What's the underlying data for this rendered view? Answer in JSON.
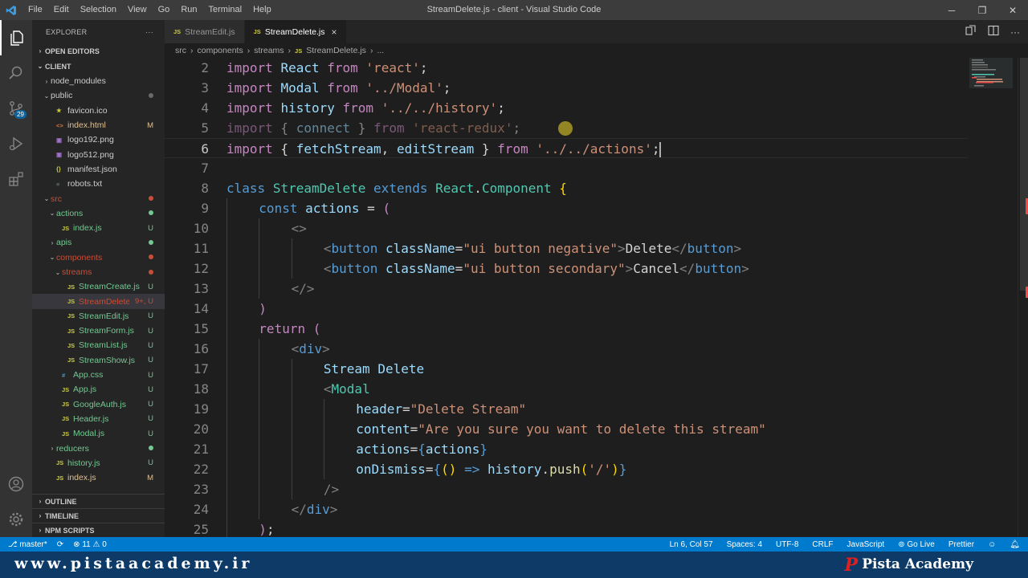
{
  "window": {
    "title": "StreamDelete.js - client - Visual Studio Code",
    "menu": [
      "File",
      "Edit",
      "Selection",
      "View",
      "Go",
      "Run",
      "Terminal",
      "Help"
    ]
  },
  "activity_badge": "29",
  "explorer": {
    "header": "EXPLORER",
    "more": "···",
    "open_editors": "OPEN EDITORS",
    "root": "CLIENT",
    "tree": [
      {
        "name": "node_modules",
        "icon": "folder",
        "depth": 1,
        "status": ""
      },
      {
        "name": "public",
        "icon": "folder-open",
        "depth": 1,
        "status": "dot",
        "status_color": "#6a6a6a"
      },
      {
        "name": "favicon.ico",
        "icon": "star",
        "depth": 2,
        "status": ""
      },
      {
        "name": "index.html",
        "icon": "html",
        "depth": 2,
        "status": "M"
      },
      {
        "name": "logo192.png",
        "icon": "image",
        "depth": 2,
        "status": ""
      },
      {
        "name": "logo512.png",
        "icon": "image",
        "depth": 2,
        "status": ""
      },
      {
        "name": "manifest.json",
        "icon": "json",
        "depth": 2,
        "status": ""
      },
      {
        "name": "robots.txt",
        "icon": "text",
        "depth": 2,
        "status": ""
      },
      {
        "name": "src",
        "icon": "folder-open",
        "depth": 1,
        "status": "dot",
        "status_color": "#c74e39"
      },
      {
        "name": "actions",
        "icon": "folder-open",
        "depth": 2,
        "status": "dot",
        "status_color": "#73c991"
      },
      {
        "name": "index.js",
        "icon": "js",
        "depth": 3,
        "status": "U"
      },
      {
        "name": "apis",
        "icon": "folder",
        "depth": 2,
        "status": "dot",
        "status_color": "#73c991"
      },
      {
        "name": "components",
        "icon": "folder-open",
        "depth": 2,
        "status": "dot",
        "status_color": "#c74e39"
      },
      {
        "name": "streams",
        "icon": "folder-open",
        "depth": 3,
        "status": "dot",
        "status_color": "#c74e39"
      },
      {
        "name": "StreamCreate.js",
        "icon": "js",
        "depth": 4,
        "status": "U"
      },
      {
        "name": "StreamDelete.js",
        "icon": "js",
        "depth": 4,
        "status": "9+, U",
        "selected": true
      },
      {
        "name": "StreamEdit.js",
        "icon": "js",
        "depth": 4,
        "status": "U"
      },
      {
        "name": "StreamForm.js",
        "icon": "js",
        "depth": 4,
        "status": "U"
      },
      {
        "name": "StreamList.js",
        "icon": "js",
        "depth": 4,
        "status": "U"
      },
      {
        "name": "StreamShow.js",
        "icon": "js",
        "depth": 4,
        "status": "U"
      },
      {
        "name": "App.css",
        "icon": "css",
        "depth": 3,
        "status": "U"
      },
      {
        "name": "App.js",
        "icon": "js",
        "depth": 3,
        "status": "U"
      },
      {
        "name": "GoogleAuth.js",
        "icon": "js",
        "depth": 3,
        "status": "U"
      },
      {
        "name": "Header.js",
        "icon": "js",
        "depth": 3,
        "status": "U"
      },
      {
        "name": "Modal.js",
        "icon": "js",
        "depth": 3,
        "status": "U"
      },
      {
        "name": "reducers",
        "icon": "folder",
        "depth": 2,
        "status": "dot",
        "status_color": "#73c991"
      },
      {
        "name": "history.js",
        "icon": "js",
        "depth": 2,
        "status": "U"
      },
      {
        "name": "index.js",
        "icon": "js",
        "depth": 2,
        "status": "M"
      }
    ],
    "bottom_sections": [
      "OUTLINE",
      "TIMELINE",
      "NPM SCRIPTS"
    ]
  },
  "tabs": [
    {
      "label": "StreamEdit.js",
      "active": false
    },
    {
      "label": "StreamDelete.js",
      "active": true
    }
  ],
  "breadcrumb": [
    "src",
    "components",
    "streams",
    "StreamDelete.js",
    "..."
  ],
  "code": [
    {
      "n": "2",
      "html": "<span class='kc'>import</span> <span class='v'>React</span> <span class='kc'>from</span> <span class='s'>'react'</span>;"
    },
    {
      "n": "3",
      "html": "<span class='kc'>import</span> <span class='v'>Modal</span> <span class='kc'>from</span> <span class='s'>'../Modal'</span>;"
    },
    {
      "n": "4",
      "html": "<span class='kc'>import</span> <span class='v'>history</span> <span class='kc'>from</span> <span class='s'>'../../history'</span>;"
    },
    {
      "n": "5",
      "html": "<span class='dim'><span class='kc'>import</span> { <span class='v'>connect</span> } <span class='kc'>from</span> <span class='s'>'react-redux'</span>;</span>"
    },
    {
      "n": "6",
      "cur": true,
      "html": "<span class='kc'>import</span> { <span class='v'>fetchStream</span>, <span class='v'>editStream</span> } <span class='kc'>from</span> <span class='s'>'../../actions'</span>;<span class='cursor'></span>"
    },
    {
      "n": "7",
      "html": ""
    },
    {
      "n": "8",
      "html": "<span class='k'>class</span> <span class='c'>StreamDelete</span> <span class='k'>extends</span> <span class='c'>React</span>.<span class='c'>Component</span> <span class='br'>{</span>"
    },
    {
      "n": "9",
      "indent": 1,
      "html": "<span class='k'>const</span> <span class='v'>actions</span> = <span class='kc'>(</span>"
    },
    {
      "n": "10",
      "indent": 2,
      "html": "<span class='tg'>&lt;&gt;</span>"
    },
    {
      "n": "11",
      "indent": 3,
      "html": "<span class='tg'>&lt;</span><span class='k'>button</span> <span class='v'>className</span>=<span class='s'>\"ui button negative\"</span><span class='tg'>&gt;</span>Delete<span class='tg'>&lt;/</span><span class='k'>button</span><span class='tg'>&gt;</span>"
    },
    {
      "n": "12",
      "indent": 3,
      "html": "<span class='tg'>&lt;</span><span class='k'>button</span> <span class='v'>className</span>=<span class='s'>\"ui button secondary\"</span><span class='tg'>&gt;</span>Cancel<span class='tg'>&lt;/</span><span class='k'>button</span><span class='tg'>&gt;</span>"
    },
    {
      "n": "13",
      "indent": 2,
      "html": "<span class='tg'>&lt;/&gt;</span>"
    },
    {
      "n": "14",
      "indent": 1,
      "html": "<span class='kc'>)</span>"
    },
    {
      "n": "15",
      "indent": 1,
      "html": "<span class='kc'>return</span> <span class='kc'>(</span>"
    },
    {
      "n": "16",
      "indent": 2,
      "html": "<span class='tg'>&lt;</span><span class='k'>div</span><span class='tg'>&gt;</span>"
    },
    {
      "n": "17",
      "indent": 3,
      "html": "<span class='v'>Stream Delete</span>"
    },
    {
      "n": "18",
      "indent": 3,
      "html": "<span class='tg'>&lt;</span><span class='c'>Modal</span>"
    },
    {
      "n": "19",
      "indent": 4,
      "html": "<span class='v'>header</span>=<span class='s'>\"Delete Stream\"</span>"
    },
    {
      "n": "20",
      "indent": 4,
      "html": "<span class='v'>content</span>=<span class='s'>\"Are you sure you want to delete this stream\"</span>"
    },
    {
      "n": "21",
      "indent": 4,
      "html": "<span class='v'>actions</span>=<span class='k'>{</span><span class='v'>actions</span><span class='k'>}</span>"
    },
    {
      "n": "22",
      "indent": 4,
      "html": "<span class='v'>onDismiss</span>=<span class='k'>{</span><span class='br'>()</span> <span class='k'>=&gt;</span> <span class='v'>history</span>.<span class='f'>push</span><span class='br'>(</span><span class='s'>'/'</span><span class='br'>)</span><span class='k'>}</span>"
    },
    {
      "n": "23",
      "indent": 3,
      "html": "<span class='tg'>/&gt;</span>"
    },
    {
      "n": "24",
      "indent": 2,
      "html": "<span class='tg'>&lt;/</span><span class='k'>div</span><span class='tg'>&gt;</span>"
    },
    {
      "n": "25",
      "indent": 1,
      "html": "<span class='kc'>)</span>;"
    }
  ],
  "status": {
    "branch": "master*",
    "problems": "⊗ 11 ⚠ 0",
    "position": "Ln 6, Col 57",
    "spaces": "Spaces: 4",
    "encoding": "UTF-8",
    "eol": "CRLF",
    "language": "JavaScript",
    "golive": "Go Live",
    "prettier": "Prettier"
  },
  "brand": {
    "url": "www.pistaacademy.ir",
    "logo_letter": "P",
    "name": "Pista Academy"
  }
}
